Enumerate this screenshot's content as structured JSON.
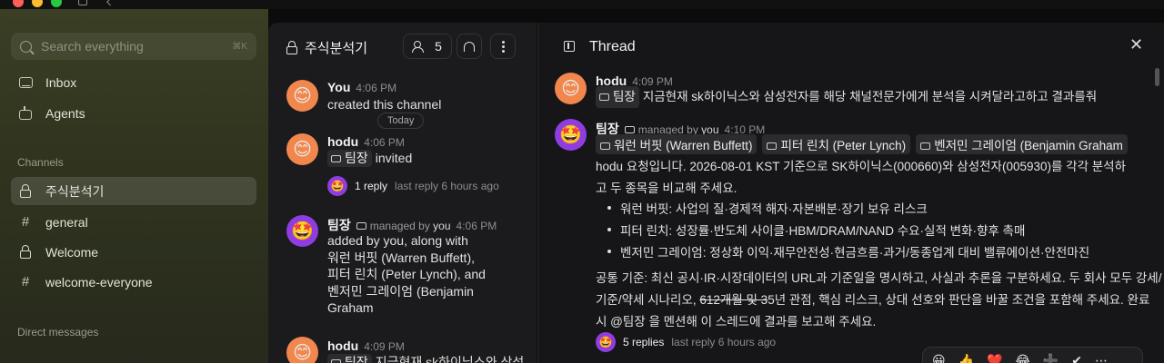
{
  "sidebar": {
    "search_placeholder": "Search everything",
    "search_shortcut": "⌘K",
    "nav": [
      {
        "label": "Inbox",
        "icon": "inbox-icon"
      },
      {
        "label": "Agents",
        "icon": "agents-icon"
      }
    ],
    "channels_label": "Channels",
    "channels": [
      {
        "label": "주식분석기",
        "icon": "lock-icon",
        "active": true
      },
      {
        "label": "general",
        "icon": "hash-icon"
      },
      {
        "label": "Welcome",
        "icon": "lock-icon"
      },
      {
        "label": "welcome-everyone",
        "icon": "hash-icon"
      }
    ],
    "dm_label": "Direct messages"
  },
  "channel": {
    "title": "주식분석기",
    "member_count": "5",
    "today_label": "Today",
    "messages": [
      {
        "author": "You",
        "time": "4:06 PM",
        "text": "created this channel"
      },
      {
        "author": "hodu",
        "time": "4:06 PM",
        "mention": "팀장",
        "text": "invited",
        "reply_count": "1 reply",
        "last_reply": "last reply 6 hours ago"
      },
      {
        "author": "팀장",
        "managed_by_prefix": "managed by",
        "managed_by": "you",
        "time": "4:06 PM",
        "lines": [
          "added by you, along with",
          "워런 버핏 (Warren Buffett),",
          "피터 린치 (Peter Lynch), and",
          "벤저민 그레이엄 (Benjamin",
          "Graham"
        ]
      },
      {
        "author": "hodu",
        "time": "4:09 PM",
        "mention": "팀장",
        "text": "지금현재 sk하이닉스와 삼성"
      }
    ]
  },
  "thread": {
    "title": "Thread",
    "root": {
      "author": "hodu",
      "time": "4:09 PM",
      "mention": "팀장",
      "text": "지금현재 sk하이닉스와 삼성전자를 해당 채널전문가에게 분석을 시켜달라고하고 결과를줘"
    },
    "reply": {
      "author": "팀장",
      "managed_by_prefix": "managed by",
      "managed_by": "you",
      "time": "4:10 PM",
      "tags": [
        "워런 버핏 (Warren Buffett)",
        "피터 린치 (Peter Lynch)",
        "벤저민 그레이엄 (Benjamin Graham"
      ],
      "para1_l1": "hodu 요청입니다. 2026-08-01 KST 기준으로 SK하이닉스(000660)와 삼성전자(005930)를 각각 분석하",
      "para1_l2": "고 두 종목을 비교해 주세요.",
      "bullets": [
        "워런 버핏: 사업의 질·경제적 해자·자본배분·장기 보유 리스크",
        "피터 린치: 성장률·반도체 사이클·HBM/DRAM/NAND 수요·실적 변화·향후 촉매",
        "벤저민 그레이엄: 정상화 이익·재무안전성·현금흐름·과거/동종업계 대비 밸류에이션·안전마진"
      ],
      "para2_l1": "공통 기준: 최신 공시·IR·시장데이터의 URL과 기준일을 명시하고, 사실과 추론을 구분하세요. 두 회사 모두 강세/",
      "para2_l2_a": "기준/약세 시나리오,",
      "para2_l2_strike": "612개월 및 3",
      "para2_l2_b": "5년 관점, 핵심 리스크, 상대 선호와 판단을 바꿀 조건을 포함해 주세요. 완료",
      "para2_l3": "시 @팀장 을 멘션해 이 스레드에 결과를 보고해 주세요.",
      "reply_count": "5 replies",
      "last_reply": "last reply 6 hours ago"
    }
  },
  "reactions": [
    "😀",
    "👍",
    "❤️",
    "😂",
    "➕",
    "✔",
    "⋯"
  ]
}
